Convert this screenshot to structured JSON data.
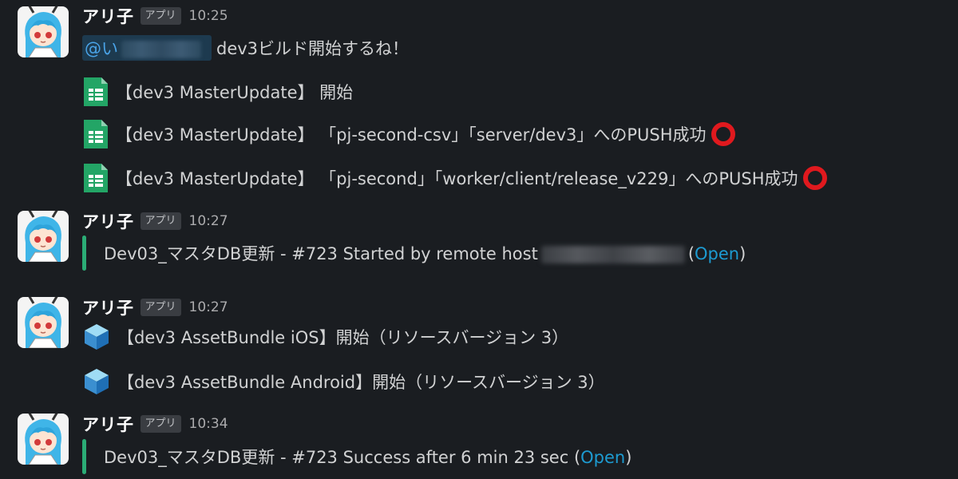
{
  "messages": [
    {
      "sender": "アリ子",
      "badge": "アプリ",
      "time": "10:25",
      "mention": "@い",
      "text": "dev3ビルド開始するね！",
      "lines": [
        "【dev3 MasterUpdate】 開始",
        "【dev3 MasterUpdate】 「pj-second-csv」「server/dev3」へのPUSH成功",
        "【dev3 MasterUpdate】 「pj-second」「worker/client/release_v229」へのPUSH成功"
      ]
    },
    {
      "sender": "アリ子",
      "badge": "アプリ",
      "time": "10:27",
      "attachment_text": "Dev03_マスタDB更新 - #723 Started by remote host",
      "link": "Open"
    },
    {
      "sender": "アリ子",
      "badge": "アプリ",
      "time": "10:27",
      "lines": [
        "【dev3 AssetBundle iOS】開始（リソースバージョン 3）",
        "【dev3 AssetBundle Android】開始（リソースバージョン 3）"
      ]
    },
    {
      "sender": "アリ子",
      "badge": "アプリ",
      "time": "10:34",
      "attachment_text": "Dev03_マスタDB更新 - #723 Success after 6 min 23 sec",
      "link": "Open"
    }
  ],
  "icons": {
    "sheet": "google-sheets-icon",
    "cube": "cube-icon",
    "success": "red-circle-icon"
  },
  "colors": {
    "background": "#1a1d21",
    "link": "#1d9bd1",
    "attachment_bar": "#2bac76",
    "success_circle": "#e0191e"
  }
}
